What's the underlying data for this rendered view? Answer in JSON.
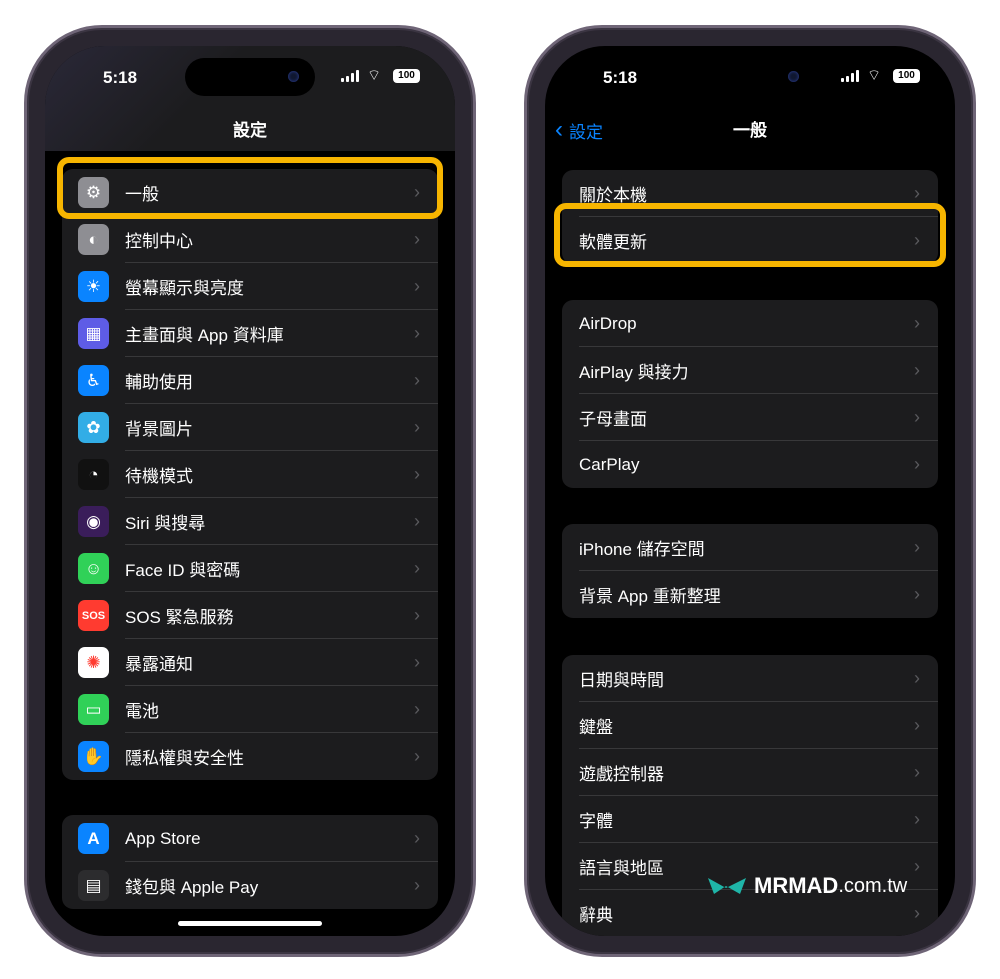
{
  "status": {
    "time": "5:18",
    "battery": "100"
  },
  "left": {
    "title": "設定",
    "groups": [
      [
        {
          "label": "一般",
          "icon": "gear-icon",
          "color": "#8e8e93",
          "glyph": "⚙"
        },
        {
          "label": "控制中心",
          "icon": "toggles-icon",
          "color": "#8e8e93",
          "glyph": "◐"
        },
        {
          "label": "螢幕顯示與亮度",
          "icon": "sun-icon",
          "color": "#0a84ff",
          "glyph": "☀"
        },
        {
          "label": "主畫面與 App 資料庫",
          "icon": "home-grid-icon",
          "color": "#5e5ce6",
          "glyph": "▦"
        },
        {
          "label": "輔助使用",
          "icon": "accessibility-icon",
          "color": "#0a84ff",
          "glyph": "♿"
        },
        {
          "label": "背景圖片",
          "icon": "flower-icon",
          "color": "#32ade6",
          "glyph": "✿"
        },
        {
          "label": "待機模式",
          "icon": "standby-icon",
          "color": "#111111",
          "glyph": "◔"
        },
        {
          "label": "Siri 與搜尋",
          "icon": "siri-icon",
          "color": "#3a1d5a",
          "glyph": "◉"
        },
        {
          "label": "Face ID 與密碼",
          "icon": "face-id-icon",
          "color": "#30d158",
          "glyph": "☺"
        },
        {
          "label": "SOS 緊急服務",
          "icon": "sos-icon",
          "color": "#ff3b30",
          "glyph": "SOS"
        },
        {
          "label": "暴露通知",
          "icon": "exposure-icon",
          "color": "#ffffff",
          "glyph": "✺"
        },
        {
          "label": "電池",
          "icon": "battery-icon",
          "color": "#30d158",
          "glyph": "▭"
        },
        {
          "label": "隱私權與安全性",
          "icon": "hand-icon",
          "color": "#0a84ff",
          "glyph": "✋"
        }
      ],
      [
        {
          "label": "App Store",
          "icon": "app-store-icon",
          "color": "#0a84ff",
          "glyph": "A"
        },
        {
          "label": "錢包與 Apple Pay",
          "icon": "wallet-icon",
          "color": "#2c2c2e",
          "glyph": "▤"
        }
      ]
    ]
  },
  "right": {
    "back": "設定",
    "title": "一般",
    "groups": [
      [
        {
          "label": "關於本機"
        },
        {
          "label": "軟體更新"
        }
      ],
      [
        {
          "label": "AirDrop"
        },
        {
          "label": "AirPlay 與接力"
        },
        {
          "label": "子母畫面"
        },
        {
          "label": "CarPlay"
        }
      ],
      [
        {
          "label": "iPhone 儲存空間"
        },
        {
          "label": "背景 App 重新整理"
        }
      ],
      [
        {
          "label": "日期與時間"
        },
        {
          "label": "鍵盤"
        },
        {
          "label": "遊戲控制器"
        },
        {
          "label": "字體"
        },
        {
          "label": "語言與地區"
        },
        {
          "label": "辭典"
        }
      ]
    ]
  },
  "highlight_color": "#f7b500",
  "watermark": {
    "brand": "MRMAD",
    "domain": ".com.tw"
  }
}
